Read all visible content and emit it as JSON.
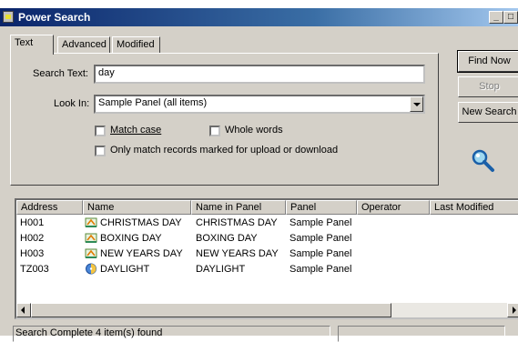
{
  "window": {
    "title": "Power Search"
  },
  "tabs": [
    {
      "label": "Text"
    },
    {
      "label": "Advanced"
    },
    {
      "label": "Modified"
    }
  ],
  "form": {
    "search_text_label": "Search Text:",
    "search_text_value": "day",
    "look_in_label": "Look In:",
    "look_in_value": "Sample Panel (all items)",
    "match_case_label": "Match case",
    "whole_words_label": "Whole words",
    "only_match_label": "Only match records marked for upload or download"
  },
  "buttons": {
    "find_now": "Find Now",
    "stop": "Stop",
    "new_search": "New Search"
  },
  "results": {
    "columns": [
      "Address",
      "Name",
      "Name in Panel",
      "Panel",
      "Operator",
      "Last Modified"
    ],
    "rows": [
      {
        "address": "H001",
        "name": "CHRISTMAS DAY",
        "name_in_panel": "CHRISTMAS DAY",
        "panel": "Sample Panel",
        "icon": "holiday-icon"
      },
      {
        "address": "H002",
        "name": "BOXING DAY",
        "name_in_panel": "BOXING DAY",
        "panel": "Sample Panel",
        "icon": "holiday-icon"
      },
      {
        "address": "H003",
        "name": "NEW YEARS DAY",
        "name_in_panel": "NEW YEARS DAY",
        "panel": "Sample Panel",
        "icon": "holiday-icon"
      },
      {
        "address": "TZ003",
        "name": "DAYLIGHT",
        "name_in_panel": "DAYLIGHT",
        "panel": "Sample Panel",
        "icon": "daylight-icon"
      }
    ]
  },
  "status": {
    "text": "Search Complete 4 item(s) found",
    "secondary": ""
  }
}
